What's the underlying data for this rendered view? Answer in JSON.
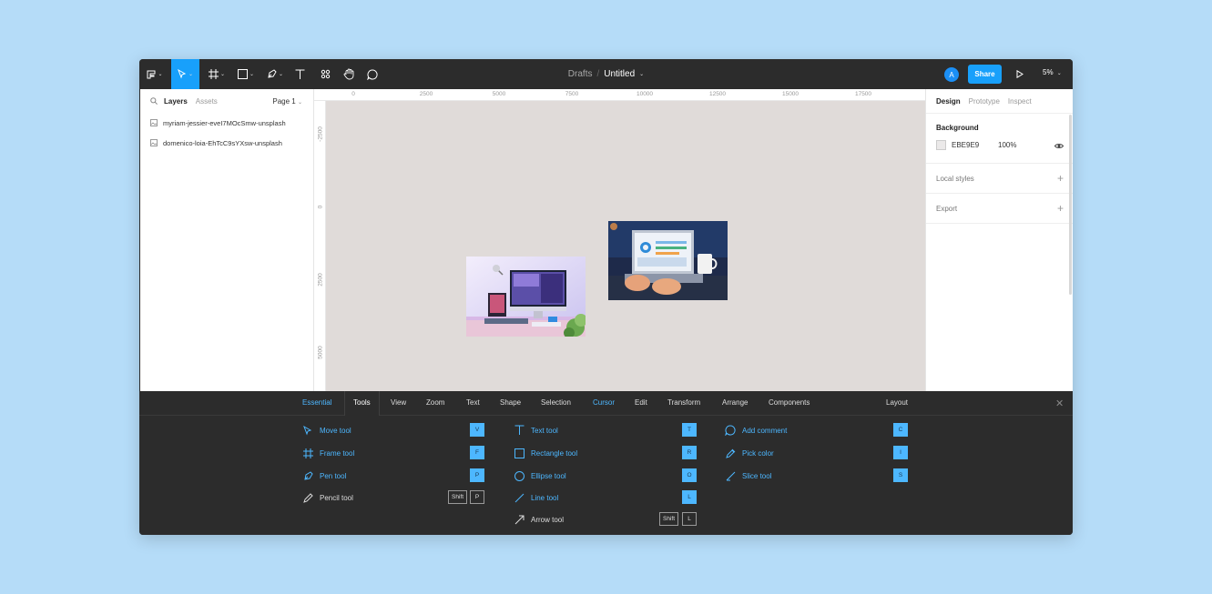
{
  "toolbar": {
    "filename": {
      "folder": "Drafts",
      "separator": "/",
      "title": "Untitled"
    },
    "avatar_initial": "A",
    "share_label": "Share",
    "zoom_label": "5%"
  },
  "left_panel": {
    "tabs": [
      "Layers",
      "Assets"
    ],
    "page_selector": "Page 1",
    "layers": [
      "myriam-jessier-eveI7MOcSmw-unsplash",
      "domenico-loia-EhTcC9sYXsw-unsplash"
    ]
  },
  "ruler": {
    "top": [
      "0",
      "2500",
      "5000",
      "7500",
      "10000",
      "12500",
      "15000",
      "17500"
    ],
    "left": [
      "-2500",
      "0",
      "2500",
      "5000"
    ]
  },
  "right_panel": {
    "tabs": [
      "Design",
      "Prototype",
      "Inspect"
    ],
    "background_heading": "Background",
    "background_hex": "EBE9E9",
    "background_opacity": "100%",
    "local_styles": "Local styles",
    "export": "Export"
  },
  "shortcuts": {
    "tabs": [
      "Essential",
      "Tools",
      "View",
      "Zoom",
      "Text",
      "Shape",
      "Selection",
      "Cursor",
      "Edit",
      "Transform",
      "Arrange",
      "Components",
      "Layout"
    ],
    "col1": [
      {
        "label": "Move tool",
        "icon": "move-icon",
        "keys": [
          "V"
        ]
      },
      {
        "label": "Frame tool",
        "icon": "frame-icon",
        "keys": [
          "F"
        ]
      },
      {
        "label": "Pen tool",
        "icon": "pen-icon",
        "keys": [
          "P"
        ]
      },
      {
        "label": "Pencil tool",
        "icon": "pencil-icon",
        "keys": [
          "Shift",
          "P"
        ]
      }
    ],
    "col2": [
      {
        "label": "Text tool",
        "icon": "text-icon",
        "keys": [
          "T"
        ]
      },
      {
        "label": "Rectangle tool",
        "icon": "rectangle-icon",
        "keys": [
          "R"
        ]
      },
      {
        "label": "Ellipse tool",
        "icon": "ellipse-icon",
        "keys": [
          "O"
        ]
      },
      {
        "label": "Line tool",
        "icon": "line-icon",
        "keys": [
          "L"
        ]
      },
      {
        "label": "Arrow tool",
        "icon": "arrow-icon",
        "keys": [
          "Shift",
          "L"
        ]
      }
    ],
    "col3": [
      {
        "label": "Add comment",
        "icon": "comment-icon",
        "keys": [
          "C"
        ]
      },
      {
        "label": "Pick color",
        "icon": "eyedropper-icon",
        "keys": [
          "I"
        ]
      },
      {
        "label": "Slice tool",
        "icon": "slice-icon",
        "keys": [
          "S"
        ]
      }
    ]
  },
  "colors": {
    "accent": "#18a0fb",
    "highlight_blue": "#4db7ff",
    "dark_bg": "#2c2c2c",
    "canvas_bg": "#e0dbd9",
    "page_bg": "#b5dcf8"
  }
}
